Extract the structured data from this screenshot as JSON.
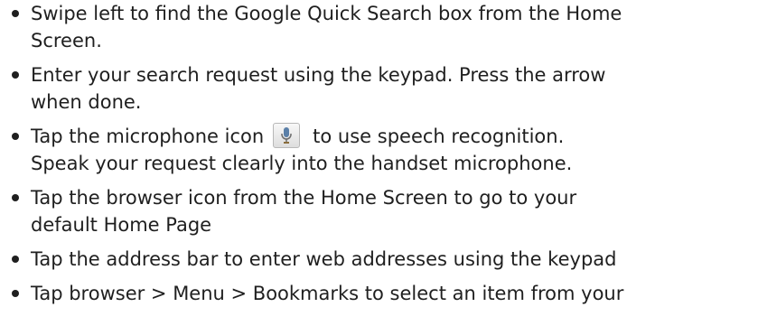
{
  "bullets": [
    {
      "line1": "Swipe left to find the Google Quick Search box from the Home",
      "line2": "Screen."
    },
    {
      "line1": "Enter your search request using the keypad. Press the arrow",
      "line2": "when done."
    },
    {
      "line1_before": "Tap the microphone icon",
      "line1_after": "to use speech recognition.",
      "line2": "Speak your request clearly into the handset microphone.",
      "icon": "microphone-icon"
    },
    {
      "line1": "Tap the browser icon from the Home Screen to go to your",
      "line2": "default Home Page"
    },
    {
      "line1": "Tap the address bar to enter web addresses using the keypad"
    },
    {
      "line1": "Tap browser > Menu > Bookmarks to select an item from your"
    }
  ]
}
